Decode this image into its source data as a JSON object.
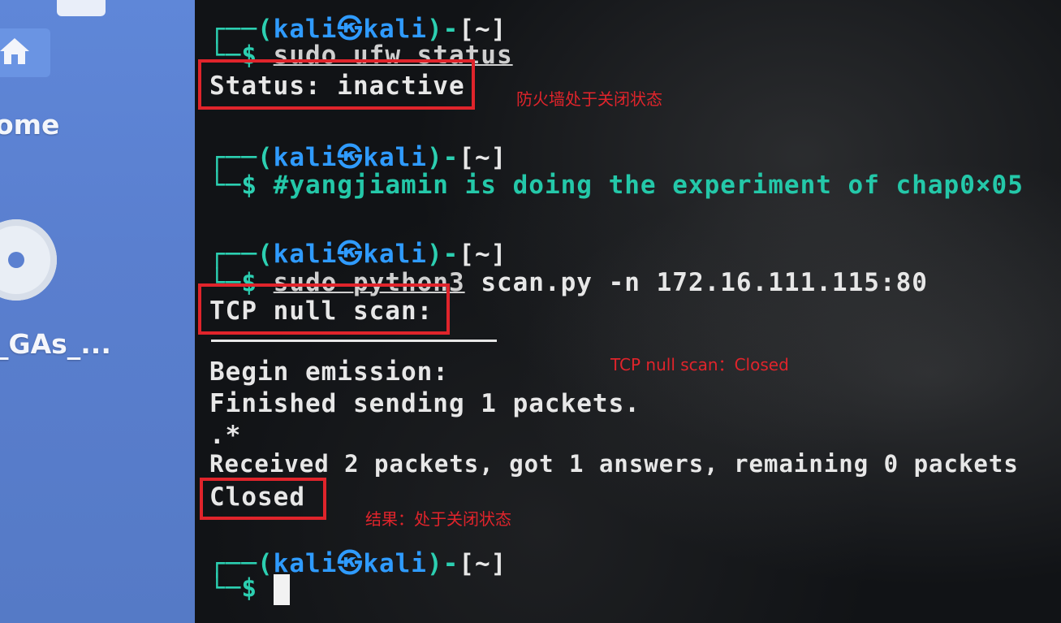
{
  "desktop": {
    "items": [
      {
        "label": "ome",
        "icon": "home-icon"
      },
      {
        "label": "_GAs_...",
        "icon": "disc-icon"
      }
    ]
  },
  "terminal": {
    "prompt": {
      "user": "kali",
      "host": "kali",
      "dir": "~",
      "symbol": "$"
    },
    "commands": [
      {
        "cmd": "sudo ufw status"
      },
      {
        "cmd": "#yangjiamin is doing the experiment of chap0×05"
      },
      {
        "cmd_dim": "sudo python3",
        "cmd": "scan.py -n 172.16.111.115:80"
      }
    ],
    "output": {
      "status": "Status: inactive",
      "scan_title": "TCP null scan:",
      "begin": "Begin emission:",
      "finished": "Finished sending 1 packets.",
      "dots": ".*",
      "received": "Received 2 packets, got 1 answers, remaining 0 packets",
      "result": "Closed"
    }
  },
  "annotations": {
    "firewall": "防火墙处于关闭状态",
    "scan": "TCP null scan：Closed",
    "result": "结果：处于关闭状态",
    "color": "#e0242b"
  },
  "colors": {
    "prompt_teal": "#2ccfb1",
    "prompt_blue": "#2f9bff",
    "text": "#e7e7e7",
    "desktop_blue": "#5a7fcf"
  }
}
